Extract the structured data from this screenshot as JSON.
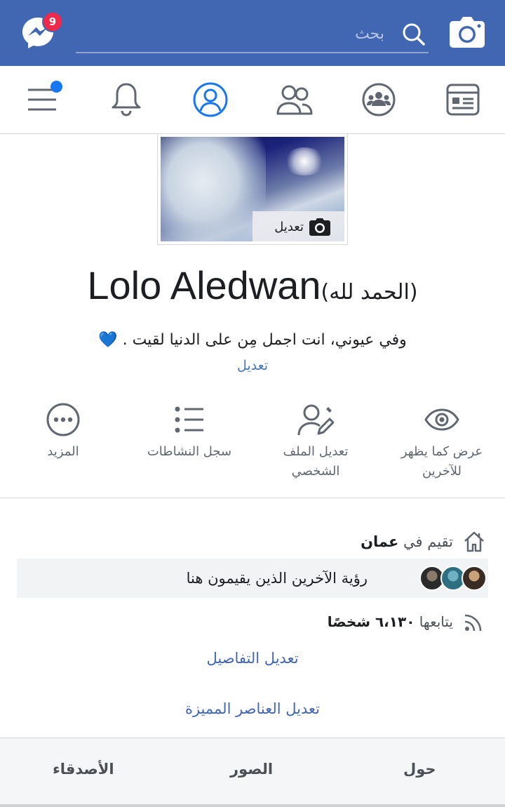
{
  "topbar": {
    "messenger_badge": "9",
    "search_placeholder": "بحث",
    "accent": "#4267b2",
    "badge_color": "#f02849"
  },
  "nav": {
    "items": [
      "news-feed",
      "groups",
      "friends",
      "profile",
      "notifications",
      "menu"
    ],
    "active": "profile",
    "menu_has_dot": true
  },
  "profile": {
    "photo_edit_label": "تعديل",
    "name_latin": "Lolo Aledwan",
    "name_arabic": "(الحمد لله)",
    "bio": "وفي عيوني، انت اجمل مِن على الدنيا لقيت .",
    "bio_emoji": "💙",
    "bio_edit": "تعديل"
  },
  "actions": [
    {
      "icon": "eye-icon",
      "label_line1": "عرض كما يظهر",
      "label_line2": "للآخرين"
    },
    {
      "icon": "edit-profile-icon",
      "label_line1": "تعديل الملف",
      "label_line2": "الشخصي"
    },
    {
      "icon": "activity-log-icon",
      "label_line1": "سجل النشاطات",
      "label_line2": ""
    },
    {
      "icon": "more-icon",
      "label_line1": "المزيد",
      "label_line2": ""
    }
  ],
  "details": {
    "lives_prefix": "تقيم في",
    "lives_city": "عمان",
    "locals_text": "رؤية الآخرين الذين يقيمون هنا",
    "followers_prefix": "يتابعها",
    "followers_count": "٦،١٣٠ شخصًا",
    "edit_details": "تعديل التفاصيل",
    "edit_featured": "تعديل العناصر المميزة"
  },
  "tabs": {
    "about": "حول",
    "photos": "الصور",
    "friends": "الأصدقاء"
  }
}
